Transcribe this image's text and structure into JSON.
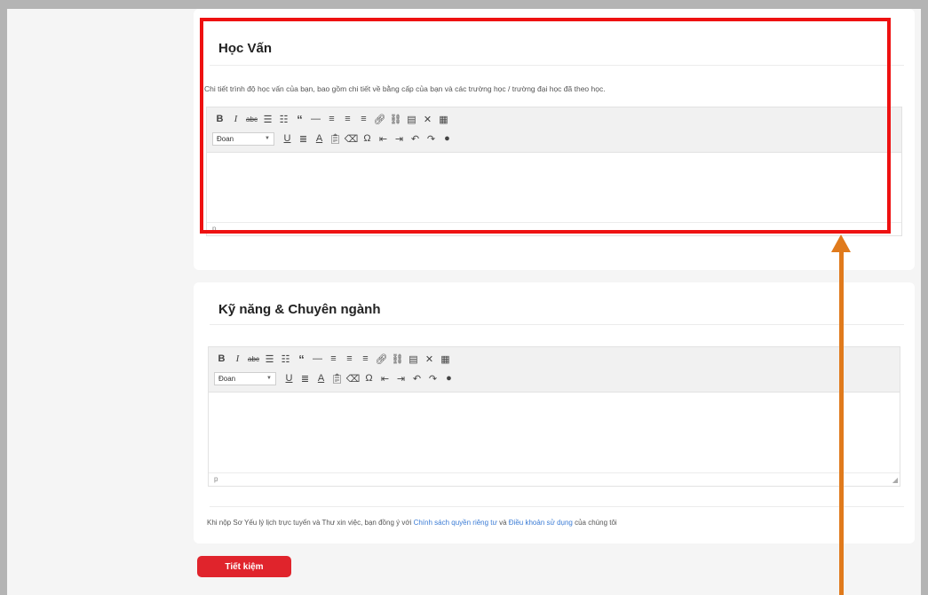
{
  "education": {
    "title": "Học Vấn",
    "description": "Chi tiết trình độ học vấn của bạn, bao gồm chi tiết về bằng cấp của bạn và các trường học / trường đại học đã theo học.",
    "editor": {
      "format_value": "Đoan",
      "status_path": "p"
    }
  },
  "skills": {
    "title": "Kỹ năng & Chuyên ngành",
    "editor": {
      "format_value": "Đoan",
      "status_path": "p"
    }
  },
  "toolbar_icons": {
    "row1": [
      "bold-icon",
      "italic-icon",
      "strikethrough-icon",
      "bullet-list-icon",
      "numbered-list-icon",
      "blockquote-icon",
      "horizontal-rule-icon",
      "align-left-icon",
      "align-center-icon",
      "align-right-icon",
      "link-icon",
      "unlink-icon",
      "read-more-icon",
      "fullscreen-icon",
      "toolbar-toggle-icon"
    ],
    "row2": [
      "underline-icon",
      "justify-icon",
      "text-color-icon",
      "paste-text-icon",
      "clear-formatting-icon",
      "special-character-icon",
      "outdent-icon",
      "indent-icon",
      "undo-icon",
      "redo-icon",
      "help-icon"
    ]
  },
  "consent": {
    "prefix": "Khi nộp Sơ Yếu lý lịch trực tuyến và Thư xin việc, bạn đồng ý với ",
    "privacy_link": "Chính sách quyền riêng tư",
    "middle": " và ",
    "terms_link": "Điều khoản sử dụng",
    "suffix": " của chúng tôi"
  },
  "actions": {
    "save_label": "Tiết kiệm"
  },
  "colors": {
    "accent": "#e0242c",
    "highlight": "#ee1111",
    "arrow": "#e07a1c",
    "link": "#3a7bd5"
  }
}
